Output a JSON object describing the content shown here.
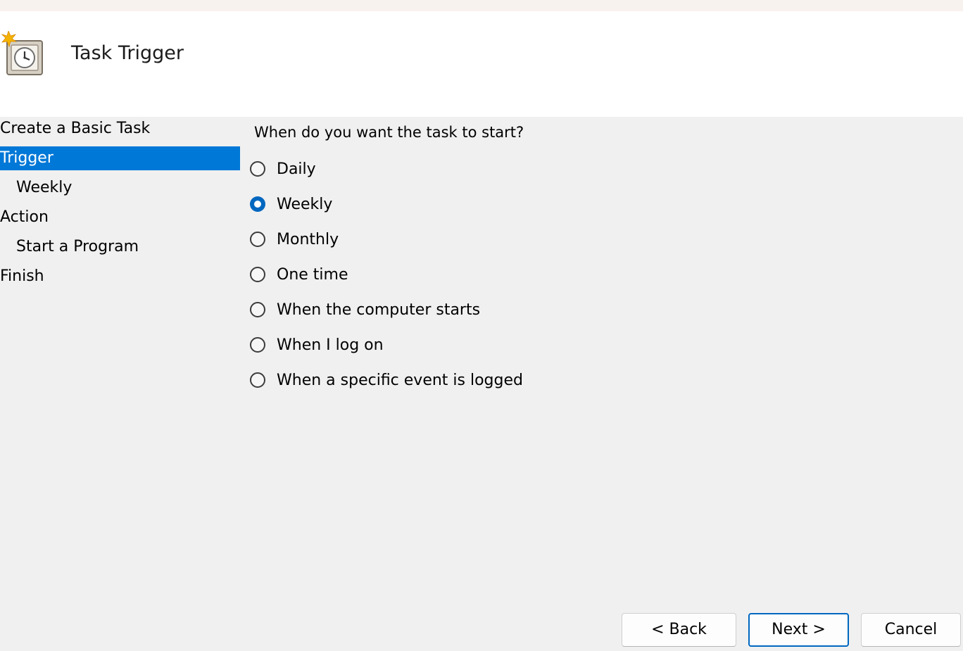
{
  "header": {
    "title": "Task Trigger",
    "icon": "scheduled-task-clock-icon"
  },
  "steps": [
    {
      "label": "Create a Basic Task",
      "level": 0,
      "active": false
    },
    {
      "label": "Trigger",
      "level": 0,
      "active": true
    },
    {
      "label": "Weekly",
      "level": 1,
      "active": false
    },
    {
      "label": "Action",
      "level": 0,
      "active": false
    },
    {
      "label": "Start a Program",
      "level": 1,
      "active": false
    },
    {
      "label": "Finish",
      "level": 0,
      "active": false
    }
  ],
  "question": "When do you want the task to start?",
  "options": [
    {
      "label": "Daily",
      "checked": false
    },
    {
      "label": "Weekly",
      "checked": true
    },
    {
      "label": "Monthly",
      "checked": false
    },
    {
      "label": "One time",
      "checked": false
    },
    {
      "label": "When the computer starts",
      "checked": false
    },
    {
      "label": "When I log on",
      "checked": false
    },
    {
      "label": "When a specific event is logged",
      "checked": false
    }
  ],
  "buttons": {
    "back": "< Back",
    "next": "Next >",
    "cancel": "Cancel"
  },
  "colors": {
    "accent": "#0078d7",
    "radio_checked": "#0067c0",
    "panel_bg": "#f0f0f0",
    "header_bg": "#ffffff"
  }
}
